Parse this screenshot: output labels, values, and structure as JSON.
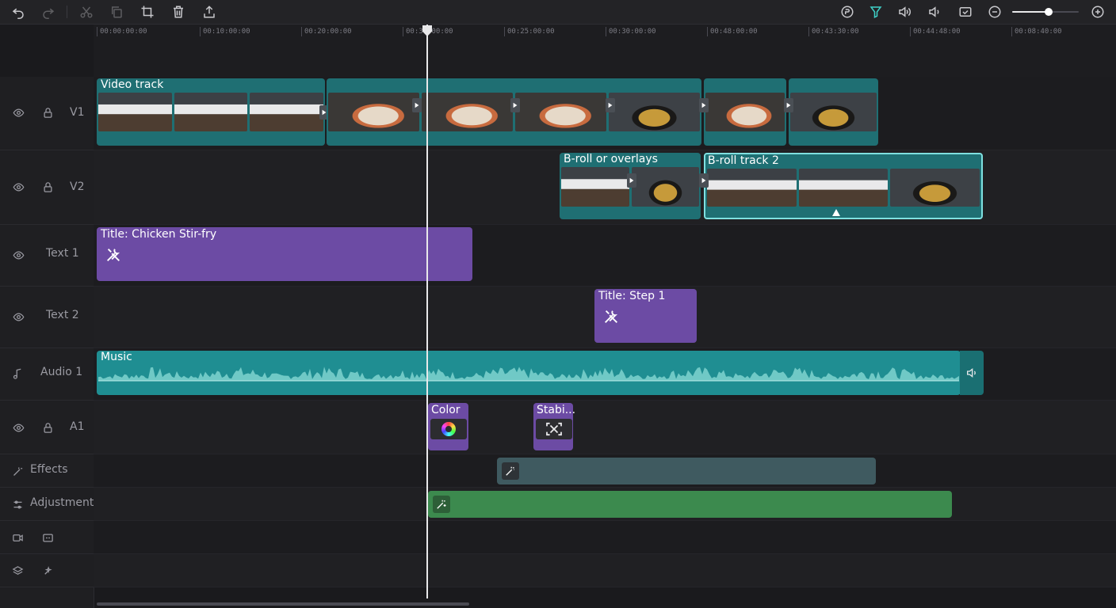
{
  "toolbar": {
    "left_icons": [
      "undo-icon",
      "redo-icon",
      "split-icon",
      "copy-icon",
      "crop-icon",
      "delete-icon",
      "export-icon"
    ],
    "right_icons": [
      "ai-icon",
      "filter-icon",
      "speaker-icon",
      "volume-icon",
      "fit-icon",
      "zoom-out-icon",
      "zoom-in-icon"
    ],
    "zoom_level": 0.55
  },
  "ruler": {
    "timecodes": [
      "00:00:00:00",
      "00:10:00:00",
      "00:20:00:00",
      "00:30:00:00",
      "00:25:00:00",
      "00:30:00:00",
      "00:48:00:00",
      "00:43:30:00",
      "00:44:48:00",
      "00:08:40:00"
    ]
  },
  "tracks": {
    "v1": {
      "label": "V1"
    },
    "v2": {
      "label": "V2"
    },
    "text1": {
      "label": "Text 1"
    },
    "text2": {
      "label": "Text 2"
    },
    "audio1": {
      "label": "Audio 1"
    },
    "a1": {
      "label": "A1"
    },
    "effects": {
      "label": "Effects"
    },
    "adjustment": {
      "label": "Adjustment"
    }
  },
  "clips": {
    "video_track": "Video track",
    "broll_overlays": "B-roll or overlays",
    "broll_track2": "B-roll track 2",
    "title_main": "Title: Chicken Stir-fry",
    "title_step": "Title: Step 1",
    "music": "Music",
    "color": "Color",
    "stabilize": "Stabi..."
  },
  "colors": {
    "video_clip": "#1f6f73",
    "text_clip": "#6c4ba4",
    "audio_clip": "#1f8e92",
    "effects_bar": "#3f5a60",
    "adjustment_bar": "#3c8a4e",
    "selection": "#7fe0e0"
  }
}
